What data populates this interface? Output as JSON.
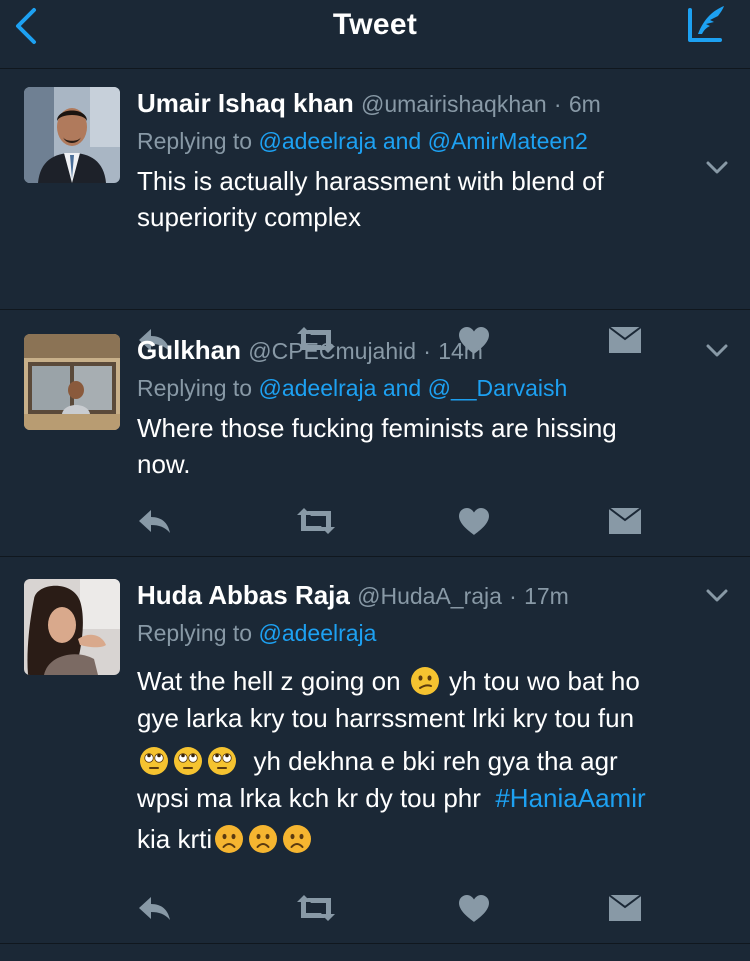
{
  "nav": {
    "title": "Tweet"
  },
  "tweets": [
    {
      "name": "Umair Ishaq khan",
      "handle": "@umairishaqkhan",
      "separator": "·",
      "time": "6m",
      "replying_prefix": "Replying to",
      "replying_mentions": [
        "@adeelraja",
        "@AmirMateen2"
      ],
      "replying_joiner": "and",
      "text_line1": "This is actually harassment with blend of",
      "text_line2": "superiority complex"
    },
    {
      "name": "Gulkhan",
      "handle": "@CPECmujahid",
      "separator": "·",
      "time": "14m",
      "replying_prefix": "Replying to",
      "replying_mentions": [
        "@adeelraja",
        "@__Darvaish"
      ],
      "replying_joiner": "and",
      "text_line1": "Where those fucking feminists are hissing",
      "text_line2": "now."
    },
    {
      "name": "Huda Abbas Raja",
      "handle": "@HudaA_raja",
      "separator": "·",
      "time": "17m",
      "replying_prefix": "Replying to",
      "replying_mentions": [
        "@adeelraja"
      ],
      "text_line1a": "Wat the hell z  going on",
      "text_line1b": "yh tou wo bat ho",
      "text_line2": "gye larka kry tou harrssment lrki kry tou fun",
      "text_line3": "yh dekhna e bki reh gya tha agr",
      "text_line4": "wpsi ma lrka kch kr dy tou phr",
      "hashtag": "#HaniaAamir",
      "text_line5": "kia krti"
    }
  ],
  "icons": {
    "back": "chevron-left-icon",
    "compose": "compose-quill-icon",
    "more": "chevron-down-icon",
    "reply": "reply-arrow-icon",
    "retweet": "retweet-icon",
    "like": "heart-icon",
    "dm": "direct-message-icon",
    "emoji_confused": "confused-face-emoji",
    "emoji_eyeroll": "eye-roll-face-emoji",
    "emoji_frown": "frowning-face-emoji"
  },
  "colors": {
    "background": "#1b2836",
    "accent": "#1da1f2",
    "secondary_text": "#8899a6",
    "divider": "#10171e"
  }
}
